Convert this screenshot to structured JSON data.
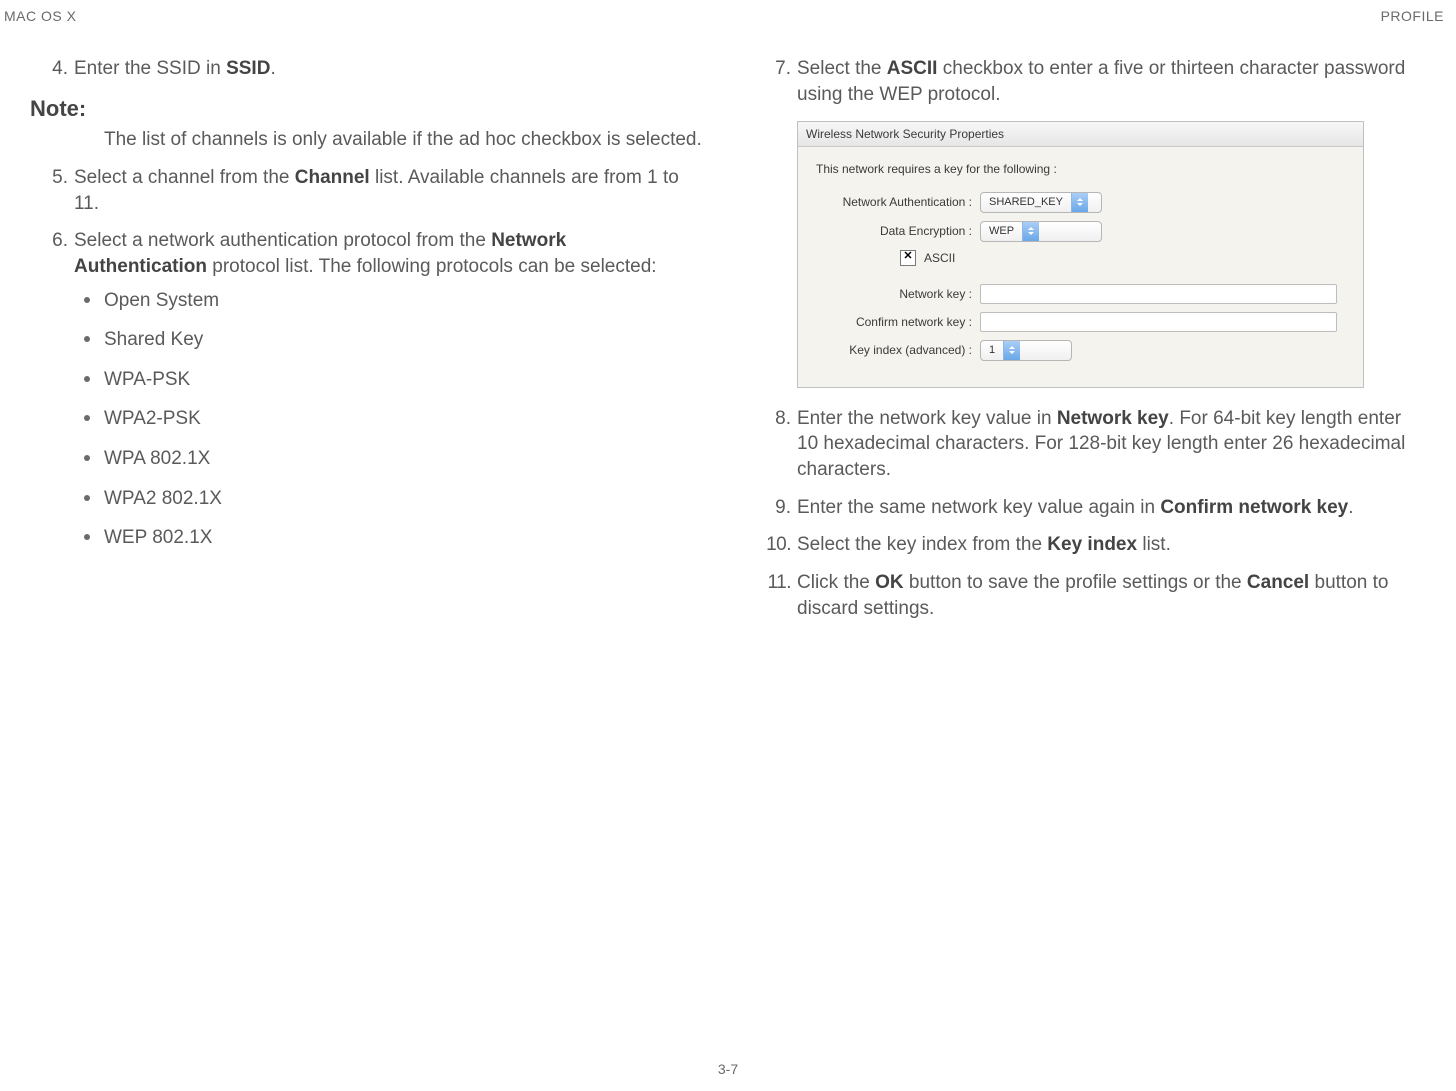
{
  "header": {
    "left": "MAC OS X",
    "right": "PROFILE"
  },
  "left_col": {
    "step4": {
      "num": "4.",
      "pre": "Enter the SSID in ",
      "b": "SSID",
      "post": "."
    },
    "note_heading": "Note:",
    "note_body": "The list of channels is only available if the ad hoc checkbox is selected.",
    "step5": {
      "num": "5.",
      "pre": "Select a channel from the ",
      "b": "Channel",
      "post": " list. Available channels are from 1 to 11."
    },
    "step6": {
      "num": "6.",
      "pre": "Select a network authentication protocol from the ",
      "b": "Network Authentication",
      "post": " protocol list. The following protocols can be selected:"
    },
    "protocols": [
      "Open System",
      "Shared Key",
      "WPA-PSK",
      "WPA2-PSK",
      "WPA 802.1X",
      "WPA2 802.1X",
      "WEP 802.1X"
    ]
  },
  "right_col": {
    "step7": {
      "num": "7.",
      "pre": "Select the ",
      "b": "ASCII",
      "post": " checkbox to enter a five or thirteen character password using the WEP protocol."
    },
    "step8": {
      "num": "8.",
      "pre": "Enter the network key value in ",
      "b": "Network key",
      "post": ". For 64-bit key length enter 10 hexadecimal characters. For 128-bit key length enter 26 hexadecimal characters."
    },
    "step9": {
      "num": "9.",
      "pre": "Enter the same network key value again in ",
      "b": "Confirm network key",
      "post": "."
    },
    "step10": {
      "num": "10.",
      "pre": "Select the key index from the ",
      "b": "Key index",
      "post": " list."
    },
    "step11": {
      "num": "11.",
      "pre": "Click the ",
      "b1": "OK",
      "mid": " button to save the profile settings or the ",
      "b2": "Cancel",
      "post": " button to discard settings."
    }
  },
  "figure": {
    "title": "Wireless Network Security Properties",
    "lead": "This network requires a key for the following :",
    "rows": {
      "auth_label": "Network Authentication :",
      "auth_value": "SHARED_KEY",
      "enc_label": "Data Encryption :",
      "enc_value": "WEP",
      "ascii_label": "ASCII",
      "ascii_checked": true,
      "netkey_label": "Network key :",
      "confirm_label": "Confirm network key :",
      "keyindex_label": "Key index (advanced) :",
      "keyindex_value": "1"
    }
  },
  "page_number": "3-7"
}
